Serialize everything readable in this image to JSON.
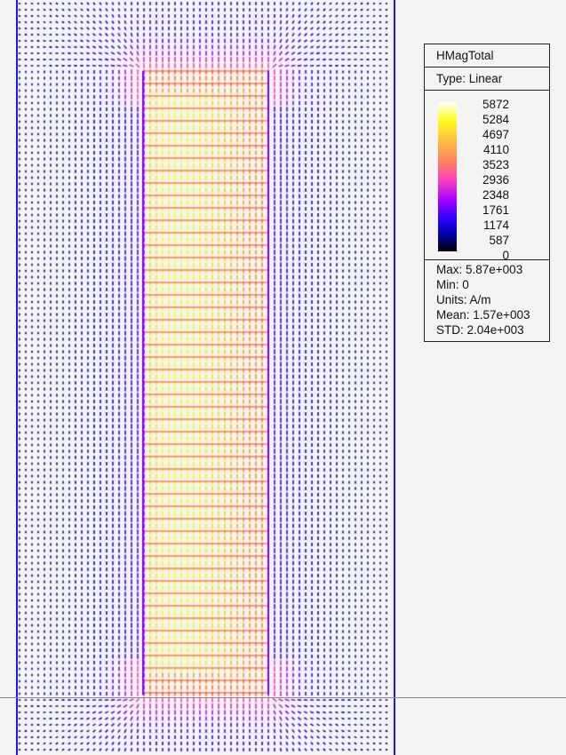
{
  "legend": {
    "quantity": "HMagTotal",
    "type": "Type: Linear",
    "ticks": [
      "5872",
      "5284",
      "4697",
      "4110",
      "3523",
      "2936",
      "2348",
      "1761",
      "1174",
      "587",
      "0"
    ],
    "stats": {
      "max": "Max: 5.87e+003",
      "min": "Min: 0",
      "units": "Units: A/m",
      "mean": "Mean: 1.57e+003",
      "std": "STD: 2.04e+003"
    }
  },
  "colors": {
    "boundary": "#1a1aff",
    "background": "#f4f4f4"
  }
}
